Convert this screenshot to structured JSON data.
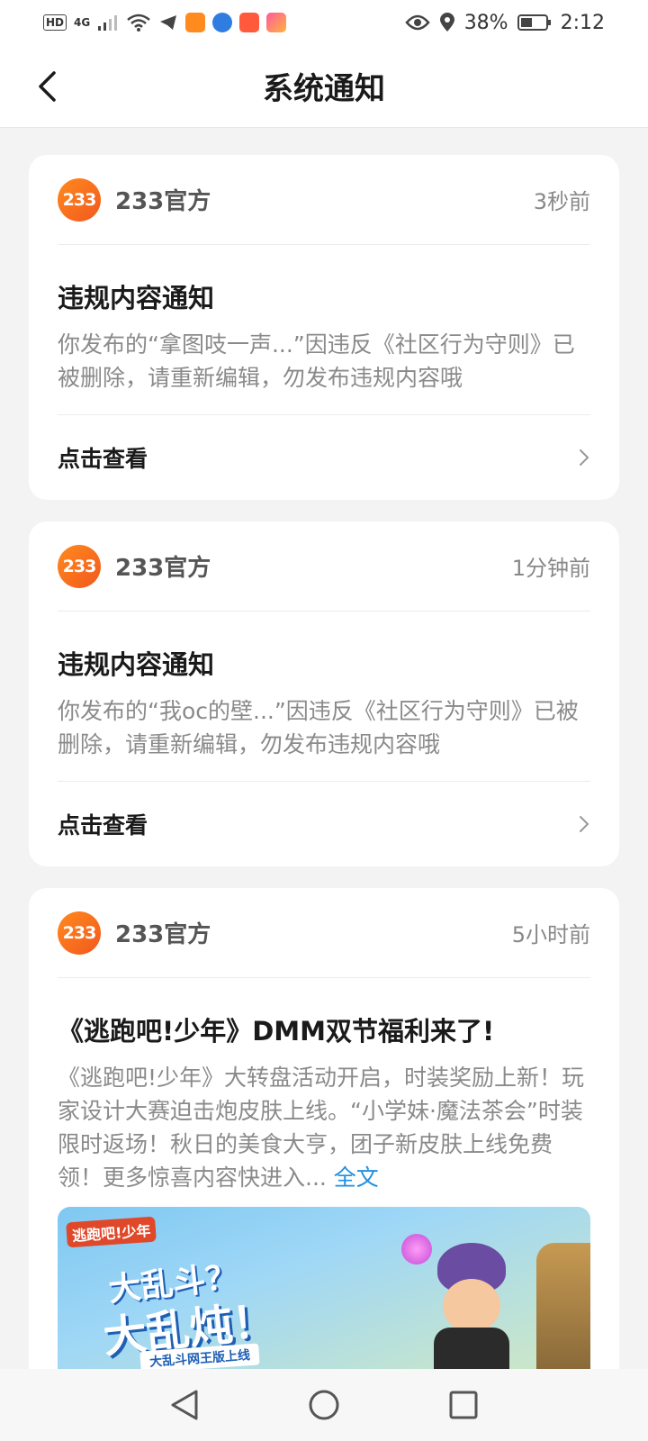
{
  "status_bar": {
    "hd_badge": "HD",
    "network": "4G",
    "battery_percent": "38%",
    "time": "2:12"
  },
  "header": {
    "title": "系统通知"
  },
  "notices": [
    {
      "sender": "233官方",
      "avatar_text": "233",
      "time": "3秒前",
      "title": "违规内容通知",
      "body": "你发布的“拿图吱一声...”因违反《社区行为守则》已被删除，请重新编辑，勿发布违规内容哦",
      "action_label": "点击查看"
    },
    {
      "sender": "233官方",
      "avatar_text": "233",
      "time": "1分钟前",
      "title": "违规内容通知",
      "body": "你发布的“我oc的壁...”因违反《社区行为守则》已被删除，请重新编辑，勿发布违规内容哦",
      "action_label": "点击查看"
    },
    {
      "sender": "233官方",
      "avatar_text": "233",
      "time": "5小时前",
      "title": "《逃跑吧!少年》DMM双节福利来了!",
      "body": "《逃跑吧!少年》大转盘活动开启，时装奖励上新！玩家设计大赛迫击炮皮肤上线。“小学妹·魔法茶会”时装限时返场！秋日的美食大亨，团子新皮肤上线免费领！更多惊喜内容快进入...",
      "more_label": "全文",
      "banner": {
        "game_logo": "逃跑吧!少年",
        "headline_line1": "大乱斗？",
        "headline_line2": "大乱炖！",
        "ribbon": "大乱斗网王版上线"
      }
    }
  ],
  "colors": {
    "accent_orange": "#f2581e",
    "link_blue": "#1e8fe1",
    "page_bg": "#f3f3f3"
  }
}
